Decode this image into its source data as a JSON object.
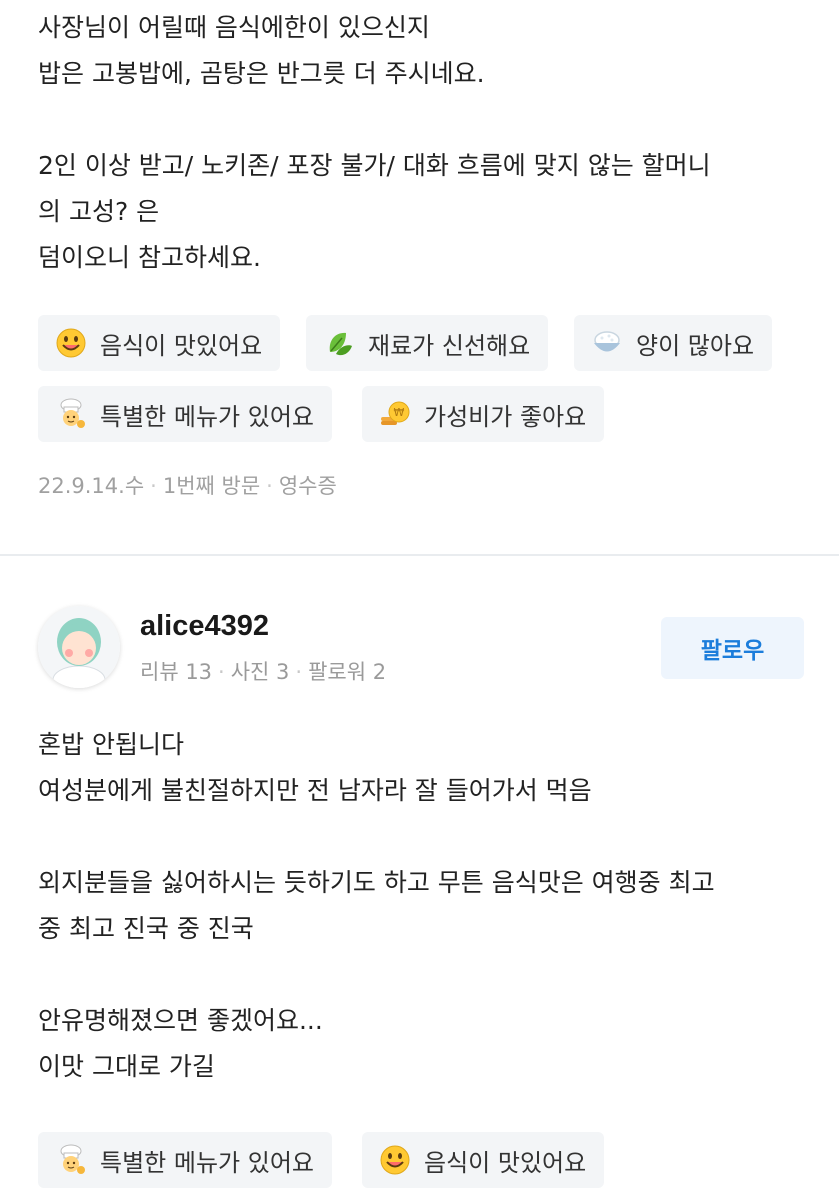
{
  "review1": {
    "lines": [
      "사장님이 어릴때 음식에한이 있으신지",
      "밥은 고봉밥에, 곰탕은 반그릇 더 주시네요.",
      "",
      "2인 이상 받고/ 노키존/ 포장 불가/ 대화 흐름에 맞지 않는 할머니",
      "의 고성? 은",
      "덤이오니 참고하세요."
    ],
    "chips": [
      {
        "label": "음식이 맛있어요",
        "icon": "smiley-icon"
      },
      {
        "label": "재료가 신선해요",
        "icon": "leaf-icon"
      },
      {
        "label": "양이 많아요",
        "icon": "rice-bowl-icon"
      },
      {
        "label": "특별한 메뉴가 있어요",
        "icon": "chef-icon"
      },
      {
        "label": "가성비가 좋아요",
        "icon": "coin-icon"
      }
    ],
    "meta": {
      "date": "22.9.14.수",
      "visit": "1번째 방문",
      "source": "영수증"
    }
  },
  "review2": {
    "user": {
      "name": "alice4392",
      "reviews": "리뷰 13",
      "photos": "사진 3",
      "followers": "팔로워 2",
      "avatar_icon": "user-avatar-icon"
    },
    "follow_label": "팔로우",
    "lines": [
      "혼밥 안됩니다",
      "여성분에게 불친절하지만 전 남자라 잘 들어가서 먹음",
      "",
      "외지분들을 싫어하시는 듯하기도 하고 무튼 음식맛은 여행중 최고",
      "중 최고 진국 중 진국",
      "",
      "안유명해졌으면 좋겠어요...",
      "이맛 그대로 가길"
    ],
    "chips": [
      {
        "label": "특별한 메뉴가 있어요",
        "icon": "chef-icon"
      },
      {
        "label": "음식이 맛있어요",
        "icon": "smiley-icon"
      }
    ]
  },
  "colors": {
    "text": "#222222",
    "chip_bg": "#f3f5f7",
    "meta_text": "#a0a0a0",
    "follow_bg": "#eef5fd",
    "follow_text": "#1c7ddb",
    "divider": "#e9ecef"
  }
}
